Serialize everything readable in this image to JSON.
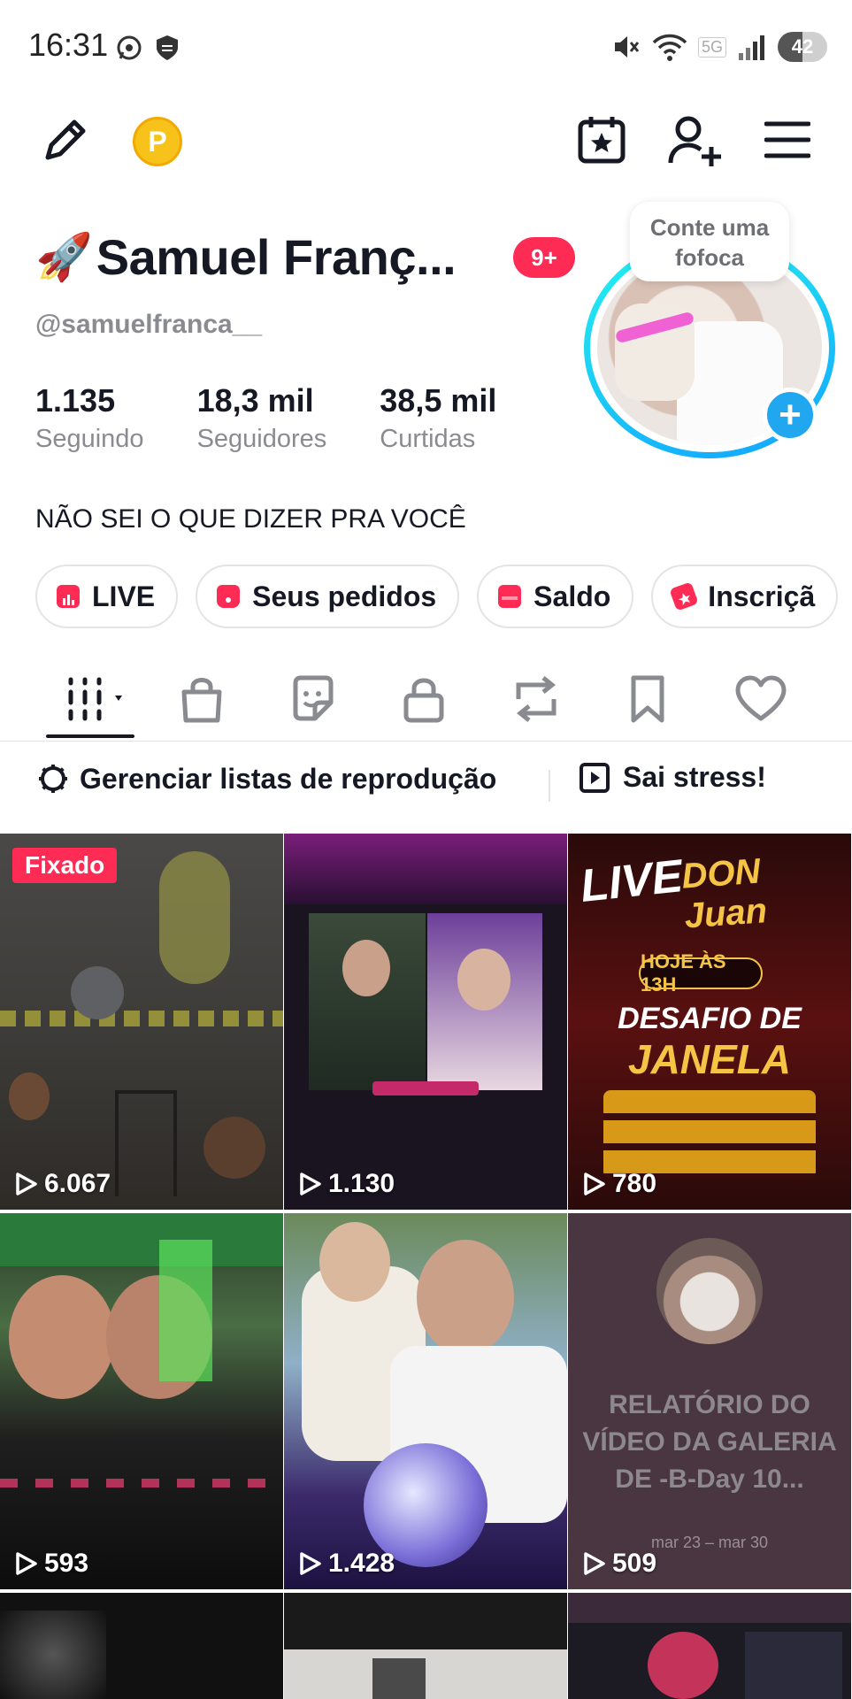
{
  "status_bar": {
    "time": "16:31",
    "battery": "42",
    "network": "5G"
  },
  "profile": {
    "rocket": "🚀",
    "display_name": "Samuel Franç...",
    "inbox_badge": "9+",
    "username": "@samuelfranca__",
    "stats": [
      {
        "value": "1.135",
        "label": "Seguindo"
      },
      {
        "value": "18,3 mil",
        "label": "Seguidores"
      },
      {
        "value": "38,5 mil",
        "label": "Curtidas"
      }
    ],
    "bio": "NÃO SEI O QUE DIZER PRA VOCÊ",
    "avatar_bubble": "Conte uma fofoca",
    "coin_letter": "P"
  },
  "pills": [
    {
      "label": "LIVE",
      "color": "#fe2c55"
    },
    {
      "label": "Seus pedidos",
      "color": "#fe2c55"
    },
    {
      "label": "Saldo",
      "color": "#fe2c55"
    },
    {
      "label": "Inscriçã",
      "color": "#fe2c55"
    }
  ],
  "tabs": [
    "videos-tab",
    "shop-tab",
    "stickers-tab",
    "private-tab",
    "reposts-tab",
    "favorites-tab",
    "liked-tab"
  ],
  "playlist_row": {
    "manage_label": "Gerenciar listas de reprodução",
    "playlist_label": "Sai stress!"
  },
  "grid": [
    {
      "views": "6.067",
      "pinned": "Fixado"
    },
    {
      "views": "1.130"
    },
    {
      "views": "780",
      "poster": {
        "line1": "LIVE",
        "line2": "DON Juan",
        "line3": "HOJE ÀS 13H",
        "line4": "DESAFIO DE",
        "line5": "JANELA"
      }
    },
    {
      "views": "593"
    },
    {
      "views": "1.428"
    },
    {
      "views": "509",
      "text": [
        "RELATÓRIO DO",
        "VÍDEO DA GALERIA",
        "DE -B-Day 10..."
      ],
      "sub": "mar 23 – mar 30"
    }
  ],
  "colors": {
    "accent": "#fe2c55",
    "ring": "#25f4ee",
    "coin": "#f7c21a"
  }
}
